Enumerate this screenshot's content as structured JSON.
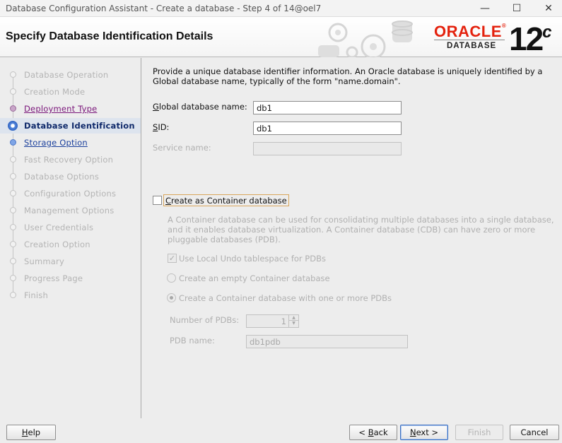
{
  "window": {
    "title": "Database Configuration Assistant - Create a database - Step 4 of 14@oel7",
    "minimize_icon": "minimize-icon",
    "maximize_icon": "maximize-icon",
    "close_icon": "close-icon"
  },
  "header": {
    "title": "Specify Database Identification Details",
    "logo_word": "ORACLE",
    "logo_reg": "®",
    "logo_sub": "DATABASE",
    "version": "12",
    "version_suffix": "c"
  },
  "sidebar": {
    "steps": [
      {
        "label": "Database Operation",
        "state": "disabled"
      },
      {
        "label": "Creation Mode",
        "state": "disabled"
      },
      {
        "label": "Deployment Type",
        "state": "visited"
      },
      {
        "label": "Database Identification",
        "state": "current"
      },
      {
        "label": "Storage Option",
        "state": "next"
      },
      {
        "label": "Fast Recovery Option",
        "state": "disabled"
      },
      {
        "label": "Database Options",
        "state": "disabled"
      },
      {
        "label": "Configuration Options",
        "state": "disabled"
      },
      {
        "label": "Management Options",
        "state": "disabled"
      },
      {
        "label": "User Credentials",
        "state": "disabled"
      },
      {
        "label": "Creation Option",
        "state": "disabled"
      },
      {
        "label": "Summary",
        "state": "disabled"
      },
      {
        "label": "Progress Page",
        "state": "disabled"
      },
      {
        "label": "Finish",
        "state": "disabled"
      }
    ]
  },
  "main": {
    "description": "Provide a unique database identifier information. An Oracle database is uniquely identified by a Global database name, typically of the form \"name.domain\".",
    "global_db_name_label": "Global database name:",
    "global_db_name_value": "db1",
    "sid_label": "SID:",
    "sid_value": "db1",
    "service_name_label": "Service name:",
    "service_name_value": "",
    "container_checkbox_label": "Create as Container database",
    "container_checked": false,
    "container_description": "A Container database can be used for consolidating multiple databases into a single database, and it enables database virtualization. A Container database (CDB) can have zero or more pluggable databases (PDB).",
    "local_undo_label": "Use Local Undo tablespace for PDBs",
    "local_undo_checked": true,
    "radio_empty_label": "Create an empty Container database",
    "radio_with_pdbs_label": "Create a Container database with one or more PDBs",
    "radio_selected": "with_pdbs",
    "num_pdbs_label": "Number of PDBs:",
    "num_pdbs_value": "1",
    "pdb_name_label": "PDB name:",
    "pdb_name_value": "db1pdb"
  },
  "footer": {
    "help_label": "Help",
    "back_label": "< Back",
    "next_label": "Next >",
    "finish_label": "Finish",
    "cancel_label": "Cancel"
  }
}
